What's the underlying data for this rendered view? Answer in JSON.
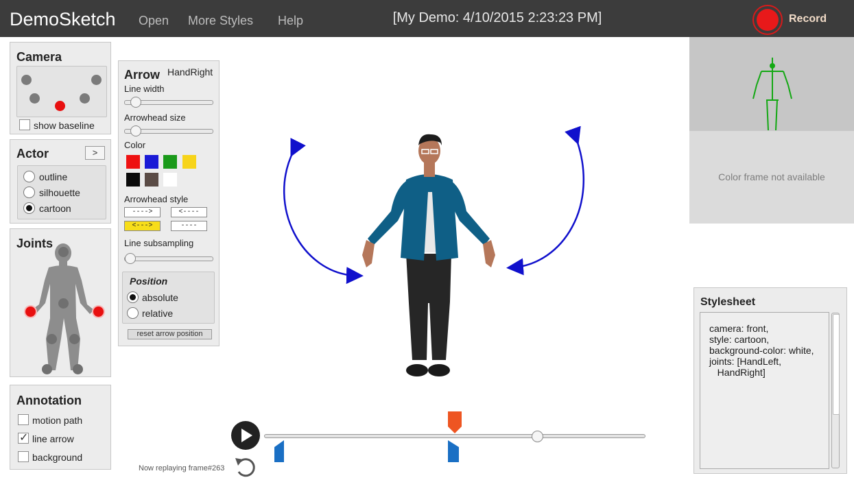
{
  "app": {
    "title": "DemoSketch"
  },
  "menu": {
    "open": "Open",
    "more_styles": "More Styles",
    "help": "Help"
  },
  "demo_title": "[My Demo: 4/10/2015 2:23:23 PM]",
  "record": {
    "label": "Record",
    "color": "#e8191a"
  },
  "camera": {
    "title": "Camera",
    "show_baseline": "show baseline",
    "show_baseline_checked": false,
    "selected_position": "front"
  },
  "actor": {
    "title": "Actor",
    "expand_label": ">",
    "options": [
      "outline",
      "silhouette",
      "cartoon"
    ],
    "selected": "cartoon"
  },
  "joints": {
    "title": "Joints",
    "selected": [
      "HandLeft",
      "HandRight"
    ]
  },
  "annotation": {
    "title": "Annotation",
    "items": [
      {
        "label": "motion path",
        "checked": false
      },
      {
        "label": "line arrow",
        "checked": true
      },
      {
        "label": "background",
        "checked": false
      }
    ]
  },
  "arrow": {
    "title": "Arrow",
    "joint": "HandRight",
    "line_width_label": "Line width",
    "arrowhead_size_label": "Arrowhead size",
    "color_label": "Color",
    "colors": [
      "#ee1111",
      "#1a1ad6",
      "#1a9a1a",
      "#f7d41a",
      "#0a0a0a",
      "#5a4b45",
      "#ffffff"
    ],
    "arrowhead_style_label": "Arrowhead style",
    "styles": [
      "---->",
      "<----",
      "<--->",
      "----"
    ],
    "selected_style": "<--->",
    "line_subsampling_label": "Line subsampling",
    "position": {
      "title": "Position",
      "options": [
        "absolute",
        "relative"
      ],
      "selected": "absolute"
    },
    "reset_label": "reset arrow position"
  },
  "preview": {
    "color_frame_text": "Color frame not available"
  },
  "stylesheet": {
    "title": "Stylesheet",
    "lines": [
      "camera: front,",
      "style: cartoon,",
      "background-color: white,",
      "joints: [HandLeft,",
      "   HandRight]"
    ]
  },
  "playback": {
    "status": "Now replaying frame#263",
    "marker_colors": {
      "current": "#ee5522",
      "segment": "#1a6fc4"
    },
    "annotation_arrow_color": "#1010cc"
  }
}
